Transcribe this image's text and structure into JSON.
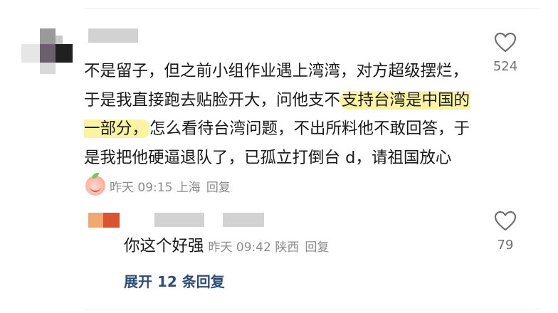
{
  "comment": {
    "text_before_highlight": "不是留子，但之前小组作业遇上湾湾，对方超级摆烂，于是我直接跑去贴脸开大，问他支不",
    "highlight_text": "支持台湾是中国的一部分，",
    "text_after_highlight": "怎么看待台湾问题，不出所料他不敢回答，于是我把他硬逼退队了，已孤立打倒台 d，请祖国放心",
    "emoji": "peach-face-emoji",
    "time": "昨天 09:15",
    "location": "上海",
    "reply_label": "回复",
    "like_count": "524"
  },
  "reply": {
    "text": "你这个好强",
    "time": "昨天 09:42",
    "location": "陕西",
    "reply_label": "回复",
    "like_count": "79"
  },
  "expand_replies_label": "展开 12 条回复",
  "icons": {
    "like": "heart-outline-icon"
  },
  "colors": {
    "highlight": "#fbf3a4",
    "link": "#2f4d7a",
    "meta": "#8b8b8b"
  }
}
